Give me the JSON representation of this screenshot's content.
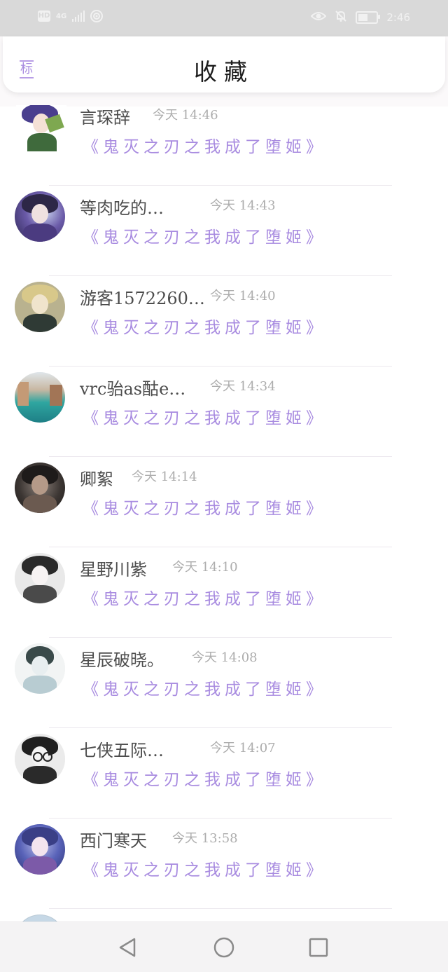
{
  "status_bar": {
    "hd": "HD",
    "network": "4G",
    "time": "2:46",
    "icons": [
      "signal-icon",
      "wifi-icon",
      "eye-icon",
      "bell-off-icon",
      "battery-icon"
    ]
  },
  "header": {
    "left_label": "标",
    "title": "收藏"
  },
  "list": {
    "items": [
      {
        "name": "言琛辞",
        "time": "今天 14:46",
        "book": "《鬼灭之刃之我成了堕姬》",
        "avatar": "avatar-anime-boy"
      },
      {
        "name": "等肉吃的…",
        "time": "今天 14:43",
        "book": "《鬼灭之刃之我成了堕姬》",
        "avatar": "avatar-anime-purple"
      },
      {
        "name": "游客1572260…",
        "time": "今天 14:40",
        "book": "《鬼灭之刃之我成了堕姬》",
        "avatar": "avatar-anime-blonde"
      },
      {
        "name": "vrc骀as酤e…",
        "time": "今天 14:34",
        "book": "《鬼灭之刃之我成了堕姬》",
        "avatar": "avatar-venice"
      },
      {
        "name": "卿絮",
        "time": "今天 14:14",
        "book": "《鬼灭之刃之我成了堕姬》",
        "avatar": "avatar-dark-figure"
      },
      {
        "name": "星野川紫",
        "time": "今天 14:10",
        "book": "《鬼灭之刃之我成了堕姬》",
        "avatar": "avatar-anime-white"
      },
      {
        "name": "星辰破晓。",
        "time": "今天 14:08",
        "book": "《鬼灭之刃之我成了堕姬》",
        "avatar": "avatar-ink"
      },
      {
        "name": "七侠五际…",
        "time": "今天 14:07",
        "book": "《鬼灭之刃之我成了堕姬》",
        "avatar": "avatar-glasses"
      },
      {
        "name": "西门寒天",
        "time": "今天 13:58",
        "book": "《鬼灭之刃之我成了堕姬》",
        "avatar": "avatar-anime-blue"
      }
    ]
  },
  "nav_bar": {
    "buttons": [
      "back-icon",
      "home-icon",
      "recents-icon"
    ]
  },
  "colors": {
    "accent": "#a88be0",
    "status_bar": "#d9d9d9",
    "name_text": "#4d4d4d",
    "time_text": "#adadad"
  }
}
